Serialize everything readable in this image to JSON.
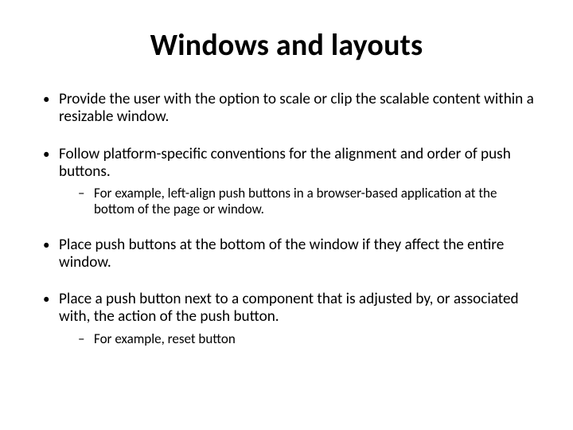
{
  "title": "Windows and layouts",
  "bullets": [
    {
      "text": "Provide the user with the option to scale or clip the scalable content within a resizable window."
    },
    {
      "text": "Follow platform-specific conventions for the alignment and order of push buttons.",
      "sub": [
        "For example, left-align push buttons in a browser-based application at the bottom of the page or window."
      ]
    },
    {
      "text": "Place push buttons at the bottom of the window if they affect the entire window."
    },
    {
      "text": "Place a push button next to a component that is adjusted by, or associated with, the action of the push button.",
      "sub": [
        "For example, reset button"
      ]
    }
  ]
}
